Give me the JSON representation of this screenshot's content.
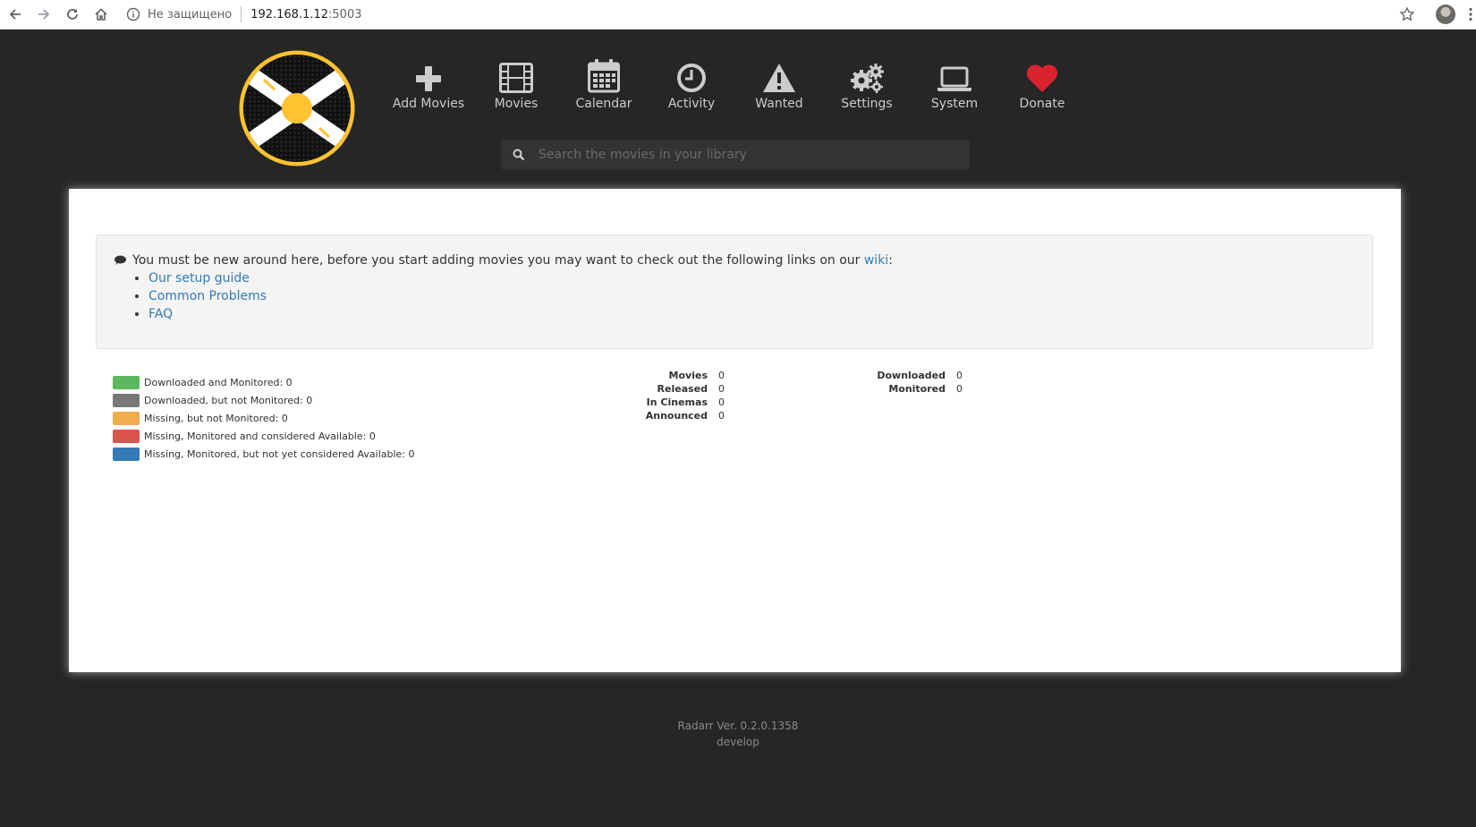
{
  "browser": {
    "security_label": "Не защищено",
    "host": "192.168.1.12",
    "port": ":5003"
  },
  "nav": [
    {
      "label": "Add Movies",
      "icon": "plus-icon"
    },
    {
      "label": "Movies",
      "icon": "film-icon"
    },
    {
      "label": "Calendar",
      "icon": "calendar-icon"
    },
    {
      "label": "Activity",
      "icon": "clock-icon"
    },
    {
      "label": "Wanted",
      "icon": "warning-icon"
    },
    {
      "label": "Settings",
      "icon": "gears-icon"
    },
    {
      "label": "System",
      "icon": "laptop-icon"
    },
    {
      "label": "Donate",
      "icon": "heart-icon"
    }
  ],
  "search": {
    "placeholder": "Search the movies in your library"
  },
  "welcome": {
    "message": "You must be new around here, before you start adding movies you may want to check out the following links on our",
    "wiki_label": "wiki",
    "colon": ":",
    "links": [
      "Our setup guide",
      "Common Problems",
      "FAQ"
    ]
  },
  "legend": [
    {
      "label": "Downloaded and Monitored: 0",
      "color": "#5cb85c"
    },
    {
      "label": "Downloaded, but not Monitored: 0",
      "color": "#777777"
    },
    {
      "label": "Missing, but not Monitored: 0",
      "color": "#f0ad4e"
    },
    {
      "label": "Missing, Monitored and considered Available: 0",
      "color": "#d9534f"
    },
    {
      "label": "Missing, Monitored, but not yet considered Available: 0",
      "color": "#337ab7"
    }
  ],
  "stats_movies": [
    {
      "label": "Movies",
      "value": "0"
    },
    {
      "label": "Released",
      "value": "0"
    },
    {
      "label": "In Cinemas",
      "value": "0"
    },
    {
      "label": "Announced",
      "value": "0"
    }
  ],
  "stats_files": [
    {
      "label": "Downloaded",
      "value": "0"
    },
    {
      "label": "Monitored",
      "value": "0"
    }
  ],
  "footer": {
    "version": "Radarr Ver. 0.2.0.1358",
    "branch": "develop"
  },
  "colors": {
    "accent": "#ffc230",
    "link": "#337ab7",
    "donate": "#d9232d",
    "background": "#262626"
  }
}
